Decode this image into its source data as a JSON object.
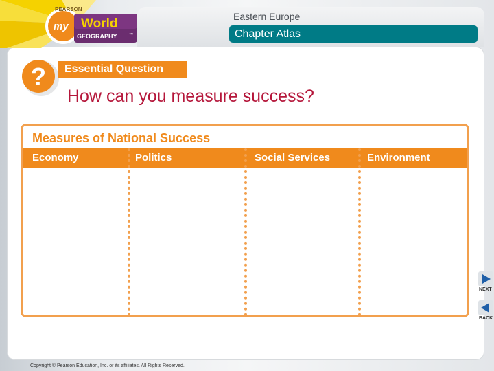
{
  "header": {
    "chapter": "Eastern Europe",
    "section": "Chapter Atlas"
  },
  "logo": {
    "brand_top": "PEARSON",
    "my": "my",
    "world": "World",
    "geography": "GEOGRAPHY",
    "trademark": "™"
  },
  "essential": {
    "label": "Essential Question",
    "question": "How can you measure success?"
  },
  "organizer": {
    "title": "Measures of National Success",
    "columns": [
      "Economy",
      "Politics",
      "Social Services",
      "Environment"
    ]
  },
  "nav": {
    "next": "NEXT",
    "back": "BACK"
  },
  "footer": {
    "copyright": "Copyright © Pearson Education, Inc. or its affiliates. All Rights Reserved."
  },
  "colors": {
    "accent_orange": "#f08a1c",
    "teal": "#007b86",
    "question_red": "#b5173b"
  }
}
